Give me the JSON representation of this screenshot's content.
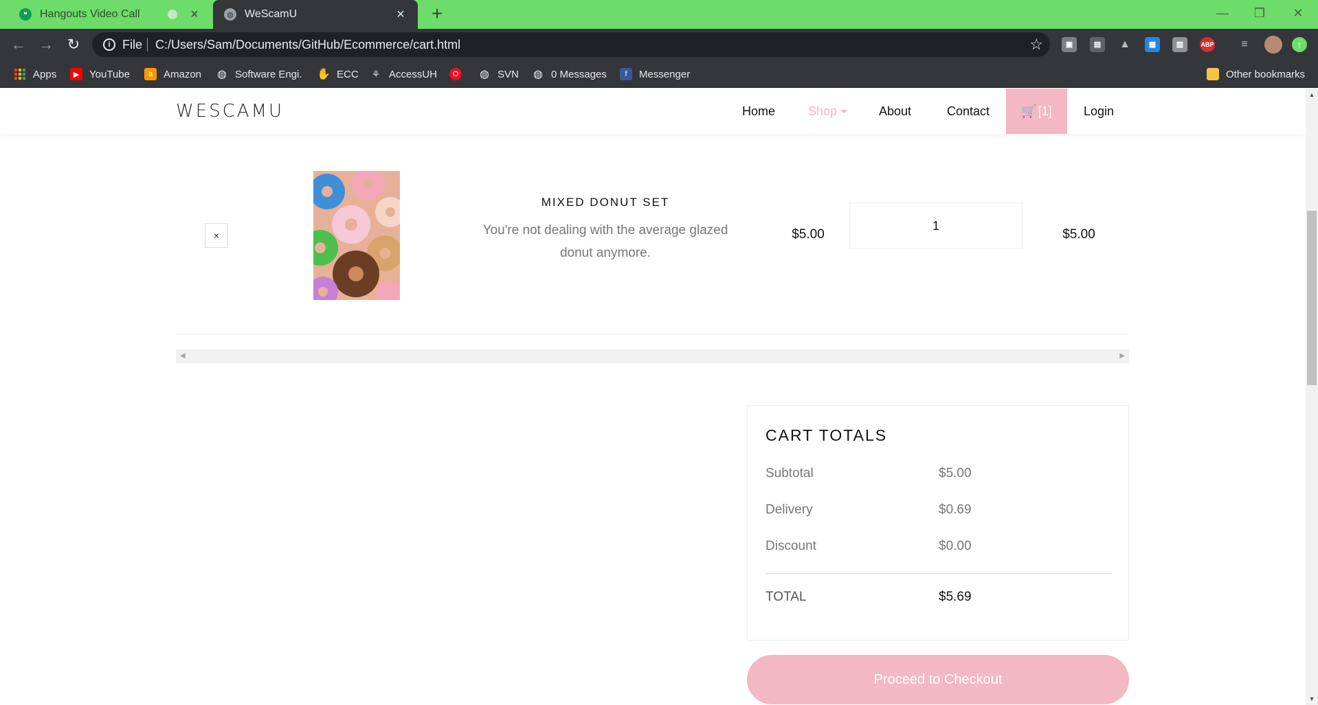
{
  "browser": {
    "tabs": [
      {
        "title": "Hangouts Video Call",
        "icon": "hangouts-icon",
        "active": false
      },
      {
        "title": "WeScamU",
        "icon": "globe-icon",
        "active": true
      }
    ],
    "address": {
      "scheme": "File",
      "url": "C:/Users/Sam/Documents/GitHub/Ecommerce/cart.html"
    },
    "extensions": [
      "extension-icon",
      "extension-icon",
      "google-drive-icon",
      "extension-icon",
      "extension-icon",
      "adblock-plus-icon"
    ],
    "adblock_label": "ABP",
    "bookmarks": [
      {
        "label": "Apps",
        "icon": "apps-grid-icon"
      },
      {
        "label": "YouTube",
        "icon": "youtube-icon"
      },
      {
        "label": "Amazon",
        "icon": "amazon-icon"
      },
      {
        "label": "Software Engi.",
        "icon": "globe-icon"
      },
      {
        "label": "ECC",
        "icon": "hand-icon"
      },
      {
        "label": "AccessUH",
        "icon": "accessuh-icon"
      },
      {
        "label": "",
        "icon": "opera-icon"
      },
      {
        "label": "SVN",
        "icon": "globe-icon"
      },
      {
        "label": "0 Messages",
        "icon": "globe-icon"
      },
      {
        "label": "Messenger",
        "icon": "facebook-icon"
      }
    ],
    "other_bookmarks": "Other bookmarks"
  },
  "site": {
    "brand": "WESCAMU",
    "nav": {
      "home": "Home",
      "shop": "Shop",
      "about": "About",
      "contact": "Contact",
      "cart": "[1]",
      "login": "Login"
    }
  },
  "cart": {
    "item": {
      "remove": "×",
      "name": "MIXED DONUT SET",
      "description": "You're not dealing with the average glazed donut anymore.",
      "price": "$5.00",
      "quantity": "1",
      "total": "$5.00"
    },
    "totals": {
      "heading": "CART TOTALS",
      "subtotal_label": "Subtotal",
      "subtotal": "$5.00",
      "delivery_label": "Delivery",
      "delivery": "$0.69",
      "discount_label": "Discount",
      "discount": "$0.00",
      "total_label": "TOTAL",
      "total": "$5.69"
    },
    "checkout": "Proceed to Checkout"
  },
  "colors": {
    "tabstrip": "#6edc6a",
    "chrome_dark": "#35363a",
    "accent_pink": "#f4b7c4"
  }
}
